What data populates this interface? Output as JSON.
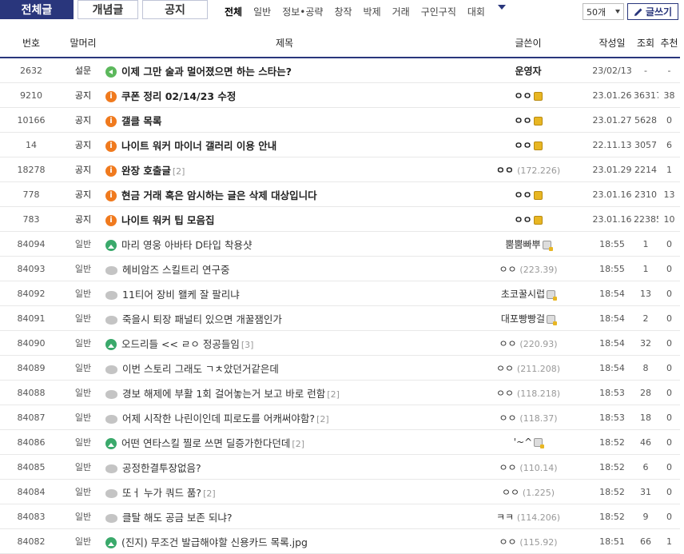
{
  "tabs": [
    "전체글",
    "개념글",
    "공지"
  ],
  "subtabs": [
    "전체",
    "일반",
    "정보•공략",
    "창작",
    "박제",
    "거래",
    "구인구직",
    "대회"
  ],
  "per_page": "50개",
  "write_label": "글쓰기",
  "columns": [
    "번호",
    "말머리",
    "제목",
    "글쓴이",
    "작성일",
    "조회",
    "추천"
  ],
  "rows": [
    {
      "num": "2632",
      "head": "설문",
      "icon": "speaker",
      "title": "이제 그만 술과 멀어졌으면 하는 스타는?",
      "count": "",
      "writer": "운영자",
      "ip": "",
      "badge": "",
      "date": "23/02/13",
      "views": "-",
      "rec": "-",
      "notice": true
    },
    {
      "num": "9210",
      "head": "공지",
      "icon": "info",
      "title": "쿠폰 정리 02/14/23 수정",
      "count": "",
      "writer": "ㅇㅇ",
      "ip": "",
      "badge": "gold",
      "date": "23.01.26",
      "views": "36317",
      "rec": "38",
      "notice": true
    },
    {
      "num": "10166",
      "head": "공지",
      "icon": "info",
      "title": "갤클 목록",
      "count": "",
      "writer": "ㅇㅇ",
      "ip": "",
      "badge": "gold",
      "date": "23.01.27",
      "views": "5628",
      "rec": "0",
      "notice": true
    },
    {
      "num": "14",
      "head": "공지",
      "icon": "info",
      "title": "나이트 워커 마이너 갤러리 이용 안내",
      "count": "",
      "writer": "ㅇㅇ",
      "ip": "",
      "badge": "gold",
      "date": "22.11.13",
      "views": "3057",
      "rec": "6",
      "notice": true
    },
    {
      "num": "18278",
      "head": "공지",
      "icon": "info",
      "title": "완장 호출글",
      "count": "[2]",
      "writer": "ㅇㅇ",
      "ip": "(172.226)",
      "badge": "",
      "date": "23.01.29",
      "views": "2214",
      "rec": "1",
      "notice": true
    },
    {
      "num": "778",
      "head": "공지",
      "icon": "info",
      "title": "현금 거래 혹은 암시하는 글은 삭제 대상입니다",
      "count": "",
      "writer": "ㅇㅇ",
      "ip": "",
      "badge": "gold",
      "date": "23.01.16",
      "views": "2310",
      "rec": "13",
      "notice": true
    },
    {
      "num": "783",
      "head": "공지",
      "icon": "info",
      "title": "나이트 워커 팁 모음집",
      "count": "",
      "writer": "ㅇㅇ",
      "ip": "",
      "badge": "gold",
      "date": "23.01.16",
      "views": "22385",
      "rec": "10",
      "notice": true
    },
    {
      "num": "84094",
      "head": "일반",
      "icon": "image",
      "title": "마리 영웅 아바타 D타입 착용샷",
      "count": "",
      "writer": "뿜뿜빠뿌",
      "ip": "",
      "badge": "gray",
      "date": "18:55",
      "views": "1",
      "rec": "0",
      "notice": false
    },
    {
      "num": "84093",
      "head": "일반",
      "icon": "chat",
      "title": "헤비암즈 스킬트리 연구중",
      "count": "",
      "writer": "ㅇㅇ",
      "ip": "(223.39)",
      "badge": "",
      "date": "18:55",
      "views": "1",
      "rec": "0",
      "notice": false
    },
    {
      "num": "84092",
      "head": "일반",
      "icon": "chat",
      "title": "11티어 장비 왤케 잘 팔리냐",
      "count": "",
      "writer": "초코꿀시럽",
      "ip": "",
      "badge": "gray",
      "date": "18:54",
      "views": "13",
      "rec": "0",
      "notice": false
    },
    {
      "num": "84091",
      "head": "일반",
      "icon": "chat",
      "title": "죽을시 퇴장 패널티 있으면 개꿀잼인가",
      "count": "",
      "writer": "대포빵빵걸",
      "ip": "",
      "badge": "gray",
      "date": "18:54",
      "views": "2",
      "rec": "0",
      "notice": false
    },
    {
      "num": "84090",
      "head": "일반",
      "icon": "image",
      "title": "오드리들 << ㄹㅇ 정공들임",
      "count": "[3]",
      "writer": "ㅇㅇ",
      "ip": "(220.93)",
      "badge": "",
      "date": "18:54",
      "views": "32",
      "rec": "0",
      "notice": false
    },
    {
      "num": "84089",
      "head": "일반",
      "icon": "chat",
      "title": "이번 스토리 그래도 ㄱㅊ았던거같은데",
      "count": "",
      "writer": "ㅇㅇ",
      "ip": "(211.208)",
      "badge": "",
      "date": "18:54",
      "views": "8",
      "rec": "0",
      "notice": false
    },
    {
      "num": "84088",
      "head": "일반",
      "icon": "chat",
      "title": "경보 해제에 부활 1회 걸어놓는거 보고 바로 런함",
      "count": "[2]",
      "writer": "ㅇㅇ",
      "ip": "(118.218)",
      "badge": "",
      "date": "18:53",
      "views": "28",
      "rec": "0",
      "notice": false
    },
    {
      "num": "84087",
      "head": "일반",
      "icon": "chat",
      "title": "어제 시작한 나린이인데 피로도를 어캐써야함?",
      "count": "[2]",
      "writer": "ㅇㅇ",
      "ip": "(118.37)",
      "badge": "",
      "date": "18:53",
      "views": "18",
      "rec": "0",
      "notice": false
    },
    {
      "num": "84086",
      "head": "일반",
      "icon": "image",
      "title": "어떤 연타스킬 찔로 쓰면 딜증가한다던데",
      "count": "[2]",
      "writer": "'~^",
      "ip": "",
      "badge": "gray",
      "date": "18:52",
      "views": "46",
      "rec": "0",
      "notice": false
    },
    {
      "num": "84085",
      "head": "일반",
      "icon": "chat",
      "title": "공정한결투장없음?",
      "count": "",
      "writer": "ㅇㅇ",
      "ip": "(110.14)",
      "badge": "",
      "date": "18:52",
      "views": "6",
      "rec": "0",
      "notice": false
    },
    {
      "num": "84084",
      "head": "일반",
      "icon": "chat",
      "title": "또ㅓ 누가 쿼드 품?",
      "count": "[2]",
      "writer": "ㅇㅇ",
      "ip": "(1.225)",
      "badge": "",
      "date": "18:52",
      "views": "31",
      "rec": "0",
      "notice": false
    },
    {
      "num": "84083",
      "head": "일반",
      "icon": "chat",
      "title": "클탈 해도 공금 보존 되냐?",
      "count": "",
      "writer": "ㅋㅋ",
      "ip": "(114.206)",
      "badge": "",
      "date": "18:52",
      "views": "9",
      "rec": "0",
      "notice": false
    },
    {
      "num": "84082",
      "head": "일반",
      "icon": "image",
      "title": "(진지) 무조건 발급해야할 신용카드 목록.jpg",
      "count": "",
      "writer": "ㅇㅇ",
      "ip": "(115.92)",
      "badge": "",
      "date": "18:51",
      "views": "66",
      "rec": "1",
      "notice": false
    }
  ]
}
